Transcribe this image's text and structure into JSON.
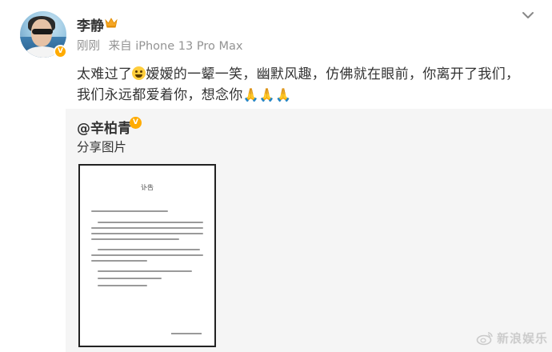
{
  "post": {
    "username": "李静",
    "time": "刚刚",
    "source": "来自 iPhone 13 Pro Max",
    "text_part1": "太难过了",
    "text_part2": "嫒嫒的一颦一笑，幽默风趣，仿佛就在眼前，你离开了我们，我们永远都爱着你，想念你",
    "pray_emojis": "🙏🙏🙏"
  },
  "repost": {
    "author": "@辛柏青",
    "text": "分享图片",
    "image": {
      "title": "讣告"
    }
  },
  "watermark": {
    "text": "新浪娱乐"
  },
  "colors": {
    "gray_text": "#939393",
    "badge_orange": "#ffab00",
    "repost_bg": "#f5f5f5"
  }
}
